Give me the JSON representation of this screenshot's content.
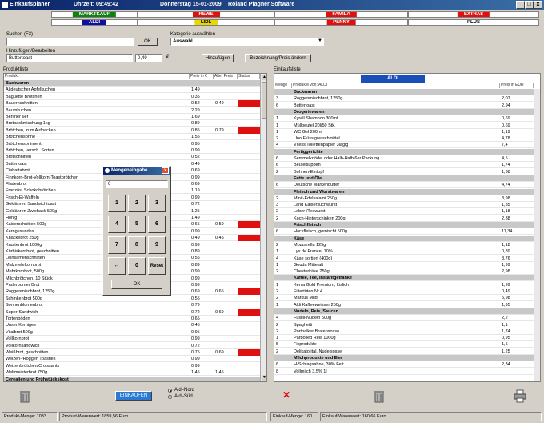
{
  "window": {
    "title": "Einkaufsplaner",
    "time": "Uhrzeit: 09:49:42",
    "date": "Donnerstag 15-01-2009",
    "company": "Roland Pfagner Software"
  },
  "shops": [
    {
      "name": "MARKTKAUF",
      "color": "#108010"
    },
    {
      "name": "REWE",
      "color": "#e01010"
    },
    {
      "name": "FAMILA",
      "color": "#e01010"
    },
    {
      "name": "EXTRAS",
      "color": "#e01010"
    },
    {
      "name": "ALDI",
      "color": "#1010a0"
    },
    {
      "name": "LIDL",
      "color": "#e8d800"
    },
    {
      "name": "PENNY",
      "color": "#e01010"
    },
    {
      "name": "PLUS",
      "color": "#ffffff"
    }
  ],
  "search": {
    "label": "Suchen (F3)",
    "value": "",
    "ok": "OK"
  },
  "category": {
    "label": "Kategorie auswählen",
    "value": "Auswahl"
  },
  "edit": {
    "label": "Hinzufügen/Bearbeiten",
    "name": "Buttertoast",
    "price": "0,49",
    "currency": "€",
    "add": "Hinzufügen",
    "rename": "Bezeichnung/Preis ändern"
  },
  "produktliste": {
    "label": "Produktliste",
    "headers": [
      "Produkt",
      "Preis in €",
      "Alter Preis",
      "Status"
    ],
    "rows": [
      [
        "Backwaren",
        "",
        "",
        "",
        "s"
      ],
      [
        "Altdeutscher Apfelkuchen",
        "1,49",
        "",
        ""
      ],
      [
        "Baguette Brötchen",
        "0,35",
        "",
        ""
      ],
      [
        "Bauernschnitten",
        "0,52",
        "0,49",
        "r"
      ],
      [
        "Baumkuchen",
        "2,29",
        "",
        ""
      ],
      [
        "Berliner 6er",
        "1,69",
        "",
        ""
      ],
      [
        "Brotbackmischung 1kg",
        "0,89",
        "",
        ""
      ],
      [
        "Brötchen, zum Aufbacken",
        "0,85",
        "0,79",
        "r"
      ],
      [
        "Brötchensonne",
        "1,55",
        "",
        ""
      ],
      [
        "Brötchensortiment",
        "0,95",
        "",
        ""
      ],
      [
        "Brötchen, versch. Sorten",
        "0,99",
        "",
        ""
      ],
      [
        "Brotschnitten",
        "0,52",
        "",
        ""
      ],
      [
        "Buttertoast",
        "0,49",
        "",
        ""
      ],
      [
        "Ciabattabrot",
        "0,69",
        "",
        ""
      ],
      [
        "Finnkorn-Brot-Vollkorn-Toastbrötchen",
        "0,99",
        "",
        ""
      ],
      [
        "Fladenbrot",
        "0,69",
        "",
        ""
      ],
      [
        "Französ. Schokobrötchen",
        "1,19",
        "",
        ""
      ],
      [
        "Frisch-Ei-Waffeln",
        "0,99",
        "",
        ""
      ],
      [
        "Goldähren Sandwichtoast",
        "0,72",
        "",
        ""
      ],
      [
        "Goldähren Zwieback 500g",
        "1,25",
        "",
        ""
      ],
      [
        "Honig",
        "1,49",
        "",
        ""
      ],
      [
        "Kaiserschnitten 500g",
        "0,65",
        "0,59",
        "r"
      ],
      [
        "Kerngesundes",
        "0,99",
        "",
        ""
      ],
      [
        "Knäckebrot 250g",
        "0,49",
        "0,45",
        "r"
      ],
      [
        "Krustenbrot 1000g",
        "0,99",
        "",
        ""
      ],
      [
        "Kürbiskernbrot, geschnitten",
        "0,89",
        "",
        ""
      ],
      [
        "Leinsamenschnitten",
        "0,55",
        "",
        ""
      ],
      [
        "Malzmehrkornbrot",
        "0,89",
        "",
        ""
      ],
      [
        "Mehrkornbrot, 500g",
        "0,99",
        "",
        ""
      ],
      [
        "Milchbrötchen, 10 Stück",
        "0,99",
        "",
        ""
      ],
      [
        "Paderborner Brot",
        "0,99",
        "",
        ""
      ],
      [
        "Roggenmischbrot, 1250g",
        "0,69",
        "0,65",
        "r"
      ],
      [
        "Schinkenbrot 500g",
        "0,55",
        "",
        ""
      ],
      [
        "Sonnenblumenbrot",
        "0,79",
        "",
        ""
      ],
      [
        "Super-Sandwich",
        "0,72",
        "0,69",
        "r"
      ],
      [
        "Tortenböden",
        "0,65",
        "",
        ""
      ],
      [
        "Unser Kerniges",
        "0,45",
        "",
        ""
      ],
      [
        "Vitalbrot 500g",
        "0,95",
        "",
        ""
      ],
      [
        "Vollkornbrot",
        "0,99",
        "",
        ""
      ],
      [
        "Vollkornsandwich",
        "0,72",
        "",
        ""
      ],
      [
        "Weißbrot, geschnitten",
        "0,75",
        "0,69",
        "r"
      ],
      [
        "Weizen-/Roggen Toasties",
        "0,99",
        "",
        ""
      ],
      [
        "Weizenbrötchen/Croissants",
        "0,99",
        "",
        ""
      ],
      [
        "Weltmeisterbrot 750g",
        "1,45",
        "1,45",
        ""
      ]
    ],
    "cutoff": "Cerealien und Frühstückskost"
  },
  "einkaufsliste": {
    "label": "Einkaufsliste",
    "shop": "ALDI",
    "headers": [
      "Menge",
      "Produkte von: ALDI",
      "Preis in EUR"
    ],
    "rows": [
      [
        "",
        "Backwaren",
        "",
        "s"
      ],
      [
        "3",
        "Roggenmischbrot, 1250g",
        "2,07",
        ""
      ],
      [
        "6",
        "Buttertoast",
        "2,94",
        ""
      ],
      [
        "",
        "Drogeriewaren",
        "",
        "s"
      ],
      [
        "1",
        "Kyrell Shampoo 300ml",
        "0,69",
        ""
      ],
      [
        "1",
        "Müllbeutel 20l/50 Stk.",
        "0,69",
        ""
      ],
      [
        "1",
        "WC Gel 200ml",
        "1,19",
        ""
      ],
      [
        "2",
        "Uno Flüssigwaschmittel",
        "4,78",
        ""
      ],
      [
        "4",
        "Vitess Toilettenpapier 3lagig",
        "7,4",
        ""
      ],
      [
        "",
        "Fertiggerichte",
        "",
        "s"
      ],
      [
        "6",
        "Semmelknödel oder Halb-Halb 6er Packung",
        "4,5",
        ""
      ],
      [
        "6",
        "Beutelsuppen",
        "1,74",
        ""
      ],
      [
        "2",
        "Bohnen-Eintopf",
        "1,38",
        ""
      ],
      [
        "",
        "Fette und Öle",
        "",
        "s"
      ],
      [
        "6",
        "Deutsche Markenbutter",
        "4,74",
        ""
      ],
      [
        "",
        "Fleisch und Wurstwaren",
        "",
        "s"
      ],
      [
        "2",
        "Minit-Edelsalami 250g",
        "3,98",
        ""
      ],
      [
        "3",
        "Land Kaisersuchwurst",
        "1,35",
        ""
      ],
      [
        "2",
        "Leber-/Teewurst",
        "1,18",
        ""
      ],
      [
        "2",
        "Koch-Hinterschinken 200g",
        "2,38",
        ""
      ],
      [
        "",
        "Frischfleisch",
        "",
        "s"
      ],
      [
        "6",
        "Hackfleisch, gemischt 500g",
        "11,34",
        ""
      ],
      [
        "",
        "Käse",
        "",
        "s"
      ],
      [
        "2",
        "Mozzarella 125g",
        "1,18",
        ""
      ],
      [
        "1",
        "Lys de France, 70%",
        "0,89",
        ""
      ],
      [
        "4",
        "Käse sortiert (400g)",
        "8,76",
        ""
      ],
      [
        "1",
        "Gouda Mittelalt",
        "1,99",
        ""
      ],
      [
        "2",
        "Chesterkäse 250g",
        "2,98",
        ""
      ],
      [
        "",
        "Kaffee, Tee, Instantgetränke",
        "",
        "s"
      ],
      [
        "1",
        "Kenia Gold Premium, löslich",
        "1,99",
        ""
      ],
      [
        "2",
        "Filtertüten Nr.4",
        "0,49",
        ""
      ],
      [
        "2",
        "Markus Mild",
        "5,98",
        ""
      ],
      [
        "1",
        "Aldi Kaffeeweisser 250g",
        "1,95",
        ""
      ],
      [
        "",
        "Nudeln, Reis, Saucen",
        "",
        "s"
      ],
      [
        "4",
        "Fusilli-Nudeln 500g",
        "2,2",
        ""
      ],
      [
        "2",
        "Spaghetti",
        "1,1",
        ""
      ],
      [
        "2",
        "Porthalker Bratensosse",
        "1,74",
        ""
      ],
      [
        "1",
        "Parboiled Reis 1000g",
        "0,95",
        ""
      ],
      [
        "5",
        "Fixprodukte",
        "1,5",
        ""
      ],
      [
        "2",
        "Delikato ital. Nudelsosse",
        "1,25",
        ""
      ],
      [
        "",
        "Milchprodukte und Eier",
        "",
        "s"
      ],
      [
        "6",
        "H-Schlagsahne, 30% Fett",
        "2,34",
        ""
      ],
      [
        "8",
        "Vollmilch 3,5% 1l",
        "",
        ""
      ]
    ]
  },
  "dialog": {
    "title": "Mengeneingabe",
    "value": "6",
    "keys": [
      "1",
      "2",
      "3",
      "4",
      "5",
      "6",
      "7",
      "8",
      "9",
      "←",
      "0",
      "Reset"
    ],
    "ok": "OK"
  },
  "bottom": {
    "add_button": "EINKAUFEN",
    "radio1": "Aldi-Nord",
    "radio2": "Aldi-Süd"
  },
  "status": {
    "produkt_menge": "Produkt-Menge: 1033",
    "produkt_warenwert": "Produkt-Warenwert: 1859,56 Euro",
    "einkauf_menge": "Einkauf-Menge: 160",
    "einkauf_warenwert": "Einkauf-Warenwert: 160,66 Euro"
  }
}
